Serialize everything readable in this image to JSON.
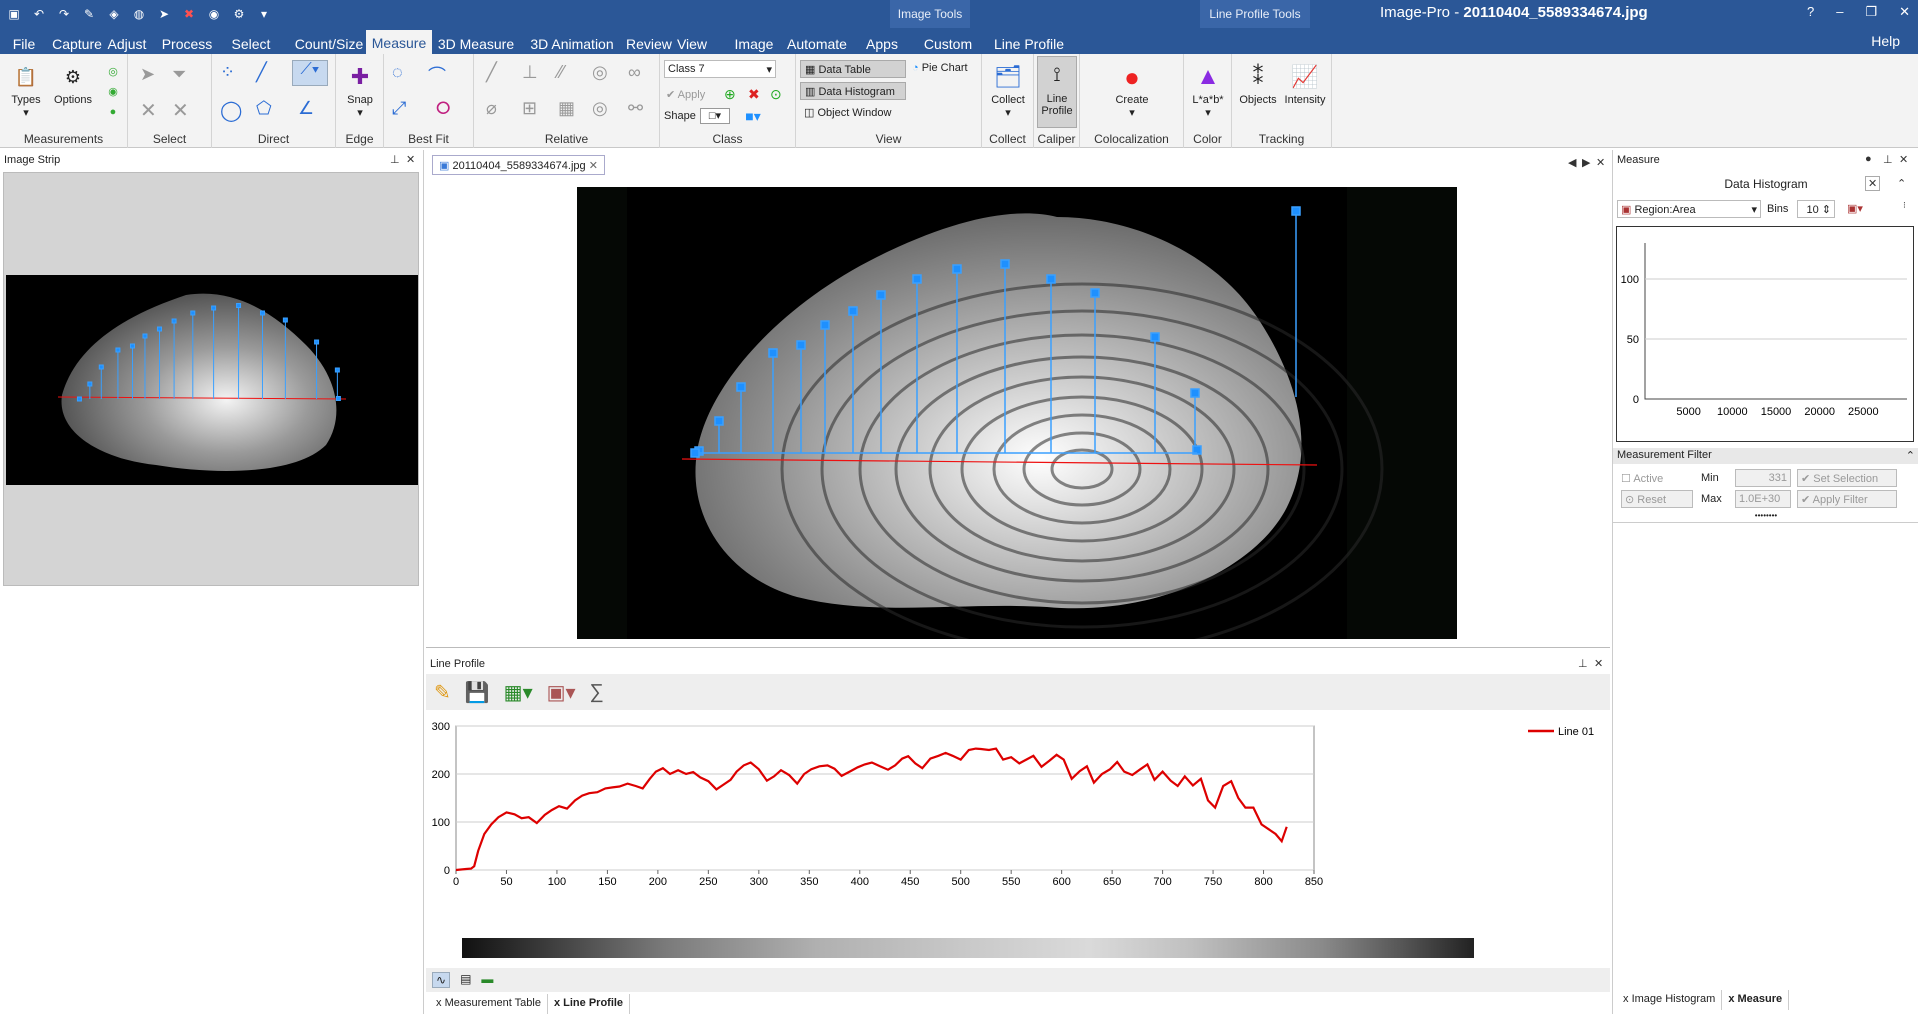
{
  "window": {
    "app": "Image-Pro",
    "sep": " - ",
    "file": "20110404_5589334674.jpg",
    "help_q": "?",
    "min": "–",
    "max": "❐",
    "close": "✕"
  },
  "context_tabs": {
    "image_tools": "Image Tools",
    "line_profile_tools": "Line Profile Tools"
  },
  "menu": {
    "tabs": [
      "File",
      "Capture",
      "Adjust",
      "Process",
      "Select",
      "Count/Size",
      "Measure",
      "3D Measure",
      "3D Animation",
      "Review",
      "View",
      "Image",
      "Automate",
      "Apps",
      "Custom",
      "Line Profile"
    ],
    "help": "Help"
  },
  "ribbon": {
    "types": "Types",
    "options": "Options",
    "measurements": "Measurements",
    "select": "Select",
    "direct": "Direct",
    "snap": "Snap",
    "edge": "Edge",
    "best_fit": "Best Fit",
    "relative": "Relative",
    "class_value": "Class 7",
    "apply": "Apply",
    "shape": "Shape",
    "class": "Class",
    "data_table": "Data Table",
    "data_histogram": "Data Histogram",
    "object_window": "Object Window",
    "pie_chart": "Pie Chart",
    "view": "View",
    "collect": "Collect",
    "line_profile": "Line Profile",
    "caliper": "Caliper",
    "create": "Create",
    "colocalization": "Colocalization",
    "lab": "L*a*b*",
    "color": "Color",
    "objects": "Objects",
    "intensity": "Intensity",
    "tracking": "Tracking"
  },
  "image_strip": {
    "title": "Image Strip"
  },
  "document": {
    "tab": "20110404_5589334674.jpg"
  },
  "line_profile": {
    "title": "Line Profile",
    "legend": "Line 01"
  },
  "bottom_tabs": [
    "Measurement Table",
    "Line Profile"
  ],
  "measure": {
    "title": "Measure",
    "histogram_title": "Data Histogram",
    "feature": "Region:Area",
    "bins_label": "Bins",
    "bins": "10",
    "filter_title": "Measurement Filter",
    "active": "Active",
    "min_label": "Min",
    "min": "331",
    "max_label": "Max",
    "max": "1.0E+30",
    "set_selection": "Set Selection",
    "reset": "Reset",
    "apply_filter": "Apply Filter"
  },
  "right_tabs": [
    "Image Histogram",
    "Measure"
  ],
  "colors": {
    "accent": "#2b5797",
    "profile": "#dd0000",
    "marker": "#1e90ff"
  },
  "hist_chart": {
    "type": "bar",
    "x_ticks": [
      5000,
      10000,
      15000,
      20000,
      25000
    ],
    "xlim": [
      0,
      30000
    ],
    "y_ticks": [
      0,
      50,
      100
    ],
    "ylim": [
      0,
      130
    ],
    "values": []
  },
  "chart_data": {
    "type": "line",
    "xlabel": "",
    "ylabel": "",
    "xlim": [
      0,
      850
    ],
    "ylim": [
      0,
      300
    ],
    "x_ticks": [
      0,
      50,
      100,
      150,
      200,
      250,
      300,
      350,
      400,
      450,
      500,
      550,
      600,
      650,
      700,
      750,
      800,
      850
    ],
    "y_ticks": [
      0,
      100,
      200,
      300
    ],
    "grid": "horizontal",
    "legend": "top-right",
    "series": [
      {
        "name": "Line 01",
        "color": "#dd0000",
        "x": [
          0,
          10,
          15,
          18,
          22,
          28,
          35,
          42,
          50,
          58,
          65,
          72,
          80,
          88,
          95,
          102,
          110,
          118,
          125,
          132,
          140,
          148,
          155,
          162,
          170,
          178,
          185,
          192,
          198,
          205,
          212,
          220,
          228,
          235,
          242,
          250,
          258,
          265,
          272,
          278,
          285,
          292,
          300,
          308,
          315,
          322,
          330,
          338,
          345,
          352,
          360,
          368,
          375,
          382,
          390,
          398,
          405,
          412,
          420,
          428,
          435,
          442,
          448,
          455,
          462,
          470,
          478,
          485,
          492,
          500,
          508,
          515,
          520,
          528,
          535,
          542,
          550,
          558,
          565,
          572,
          580,
          588,
          595,
          602,
          610,
          618,
          625,
          632,
          640,
          648,
          655,
          662,
          670,
          678,
          685,
          692,
          700,
          708,
          715,
          722,
          730,
          738,
          745,
          752,
          760,
          768,
          775,
          782,
          790,
          798,
          805,
          812,
          818,
          823
        ],
        "y": [
          0,
          2,
          3,
          8,
          40,
          75,
          95,
          110,
          120,
          116,
          108,
          110,
          98,
          115,
          125,
          133,
          128,
          145,
          155,
          160,
          162,
          170,
          172,
          174,
          180,
          175,
          170,
          190,
          205,
          212,
          200,
          208,
          200,
          204,
          193,
          185,
          168,
          178,
          188,
          205,
          218,
          224,
          210,
          186,
          195,
          208,
          198,
          180,
          200,
          210,
          216,
          218,
          211,
          196,
          205,
          214,
          220,
          224,
          216,
          209,
          218,
          232,
          237,
          222,
          212,
          232,
          238,
          244,
          238,
          230,
          250,
          253,
          252,
          250,
          253,
          230,
          235,
          222,
          230,
          238,
          215,
          228,
          240,
          230,
          190,
          206,
          216,
          182,
          200,
          210,
          225,
          205,
          198,
          210,
          220,
          188,
          205,
          186,
          175,
          195,
          176,
          190,
          145,
          130,
          175,
          185,
          150,
          130,
          130,
          95,
          85,
          75,
          60,
          90
        ]
      }
    ]
  }
}
